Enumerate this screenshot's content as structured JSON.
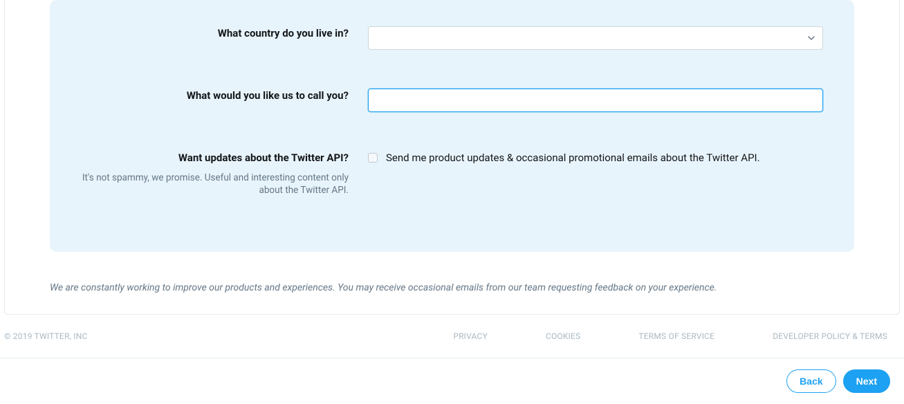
{
  "form": {
    "country": {
      "question": "What country do you live in?",
      "value": ""
    },
    "name": {
      "question": "What would you like us to call you?",
      "value": ""
    },
    "updates": {
      "question": "Want updates about the Twitter API?",
      "help": "It's not spammy, we promise. Useful and interesting content only about the Twitter API.",
      "option_label": "Send me product updates & occasional promotional emails about the Twitter API."
    }
  },
  "disclaimer": "We are constantly working to improve our products and experiences. You may receive occasional emails from our team requesting feedback on your experience.",
  "footer": {
    "copyright": "© 2019 TWITTER, INC",
    "links": {
      "privacy": "PRIVACY",
      "cookies": "COOKIES",
      "terms": "TERMS OF SERVICE",
      "dev_policy": "DEVELOPER POLICY & TERMS"
    }
  },
  "actions": {
    "back": "Back",
    "next": "Next"
  }
}
